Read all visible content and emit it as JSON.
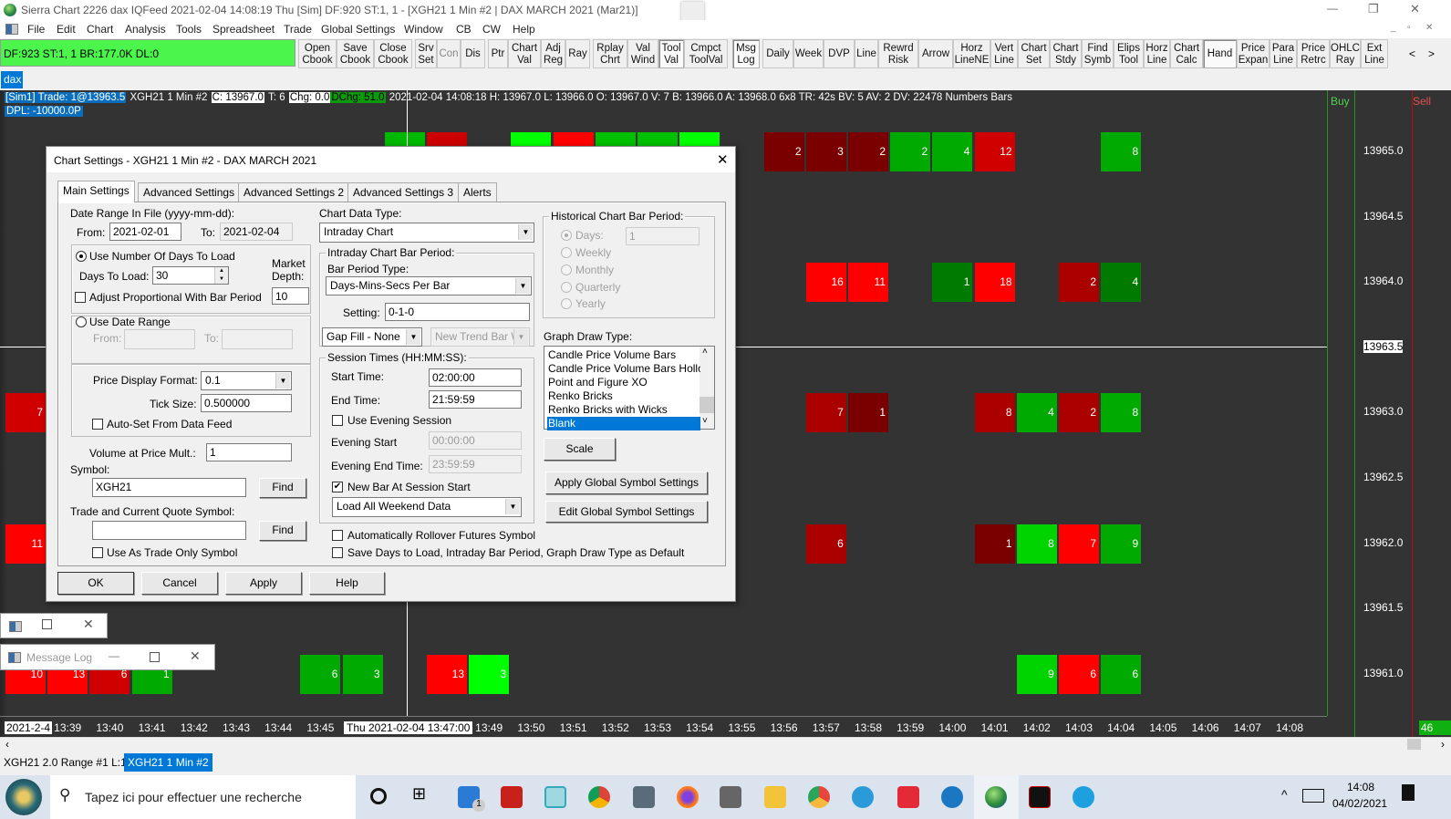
{
  "window": {
    "title": "Sierra Chart 2226 dax  IQFeed 2021-02-04  14:08:19 Thu [Sim]  DF:920  ST:1, 1 - [XGH21  1 Min   #2 | DAX MARCH 2021 (Mar21)]",
    "minimize": "—",
    "restore": "❐",
    "close": "✕"
  },
  "menu": [
    "File",
    "Edit",
    "Chart",
    "Analysis",
    "Tools",
    "Spreadsheet",
    "Trade",
    "Global Settings",
    "Window",
    "CB",
    "CW",
    "Help"
  ],
  "status_box": "DF:923  ST:1, 1  BR:177.0K  DL:0",
  "toolbar": [
    {
      "label": "Open\nCbook"
    },
    {
      "label": "Save\nCbook"
    },
    {
      "label": "Close\nCbook"
    },
    {
      "label": "Srv\nSet"
    },
    {
      "label": "Con",
      "disabled": true
    },
    {
      "label": "Dis"
    },
    {
      "label": "Ptr"
    },
    {
      "label": "Chart\nVal"
    },
    {
      "label": "Adj\nReg"
    },
    {
      "label": "Ray"
    },
    {
      "label": "Rplay\nChrt"
    },
    {
      "label": "Val\nWind"
    },
    {
      "label": "Tool\nVal",
      "pressed": true
    },
    {
      "label": "Cmpct\nToolVal"
    },
    {
      "label": "Msg\nLog",
      "pressed": true
    },
    {
      "label": "Daily"
    },
    {
      "label": "Week"
    },
    {
      "label": "DVP"
    },
    {
      "label": "Line"
    },
    {
      "label": "Rewrd\nRisk"
    },
    {
      "label": "Arrow"
    },
    {
      "label": "Horz\nLineNE"
    },
    {
      "label": "Vert\nLine"
    },
    {
      "label": "Chart\nSet"
    },
    {
      "label": "Chart\nStdy"
    },
    {
      "label": "Find\nSymb"
    },
    {
      "label": "Elips\nTool"
    },
    {
      "label": "Horz\nLine"
    },
    {
      "label": "Chart\nCalc"
    },
    {
      "label": "Hand",
      "pressed": true
    },
    {
      "label": "Price\nExpan"
    },
    {
      "label": "Para\nLine"
    },
    {
      "label": "Price\nRetrc"
    },
    {
      "label": "OHLC\nRay"
    },
    {
      "label": "Ext\nLine"
    }
  ],
  "toolbar_scroll": {
    "left": "<",
    "right": ">"
  },
  "chart_tab": "dax",
  "chart": {
    "header": {
      "trade": "[Sim1]  Trade: 1@13963.5",
      "symbol": "XGH21  1 Min   #2",
      "close": "C: 13967.0",
      "ticks": "T: 6",
      "change": "Chg: 0.0",
      "daily_change": "DChg: 51.0",
      "details": "2021-02-04 14:08:18 H: 13967.0 L: 13966.0 O: 13967.0 V: 7 B: 13966.0 A: 13968.0 6x8 TR: 42s BV: 5 AV: 2 DV: 22478 Numbers Bars"
    },
    "dpl": "DPL: -10000.0P",
    "buy_label": "Buy",
    "sell_label": "Sell",
    "price_labels": [
      "13965.0",
      "13964.5",
      "13964.0",
      "13963.5",
      "13963.0",
      "13962.5",
      "13962.0",
      "13961.5",
      "13961.0"
    ],
    "current_price": "13963.5",
    "date_label": "2021-2-4",
    "cursor_label": "Thu 2021-02-04  13:47:00",
    "time_labels": [
      "13:39",
      "13:40",
      "13:41",
      "13:42",
      "13:43",
      "13:44",
      "13:45",
      "13:49",
      "13:50",
      "13:51",
      "13:52",
      "13:53",
      "13:54",
      "13:55",
      "13:56",
      "13:57",
      "13:58",
      "13:59",
      "14:00",
      "14:01",
      "14:02",
      "14:03",
      "14:04",
      "14:05",
      "14:06",
      "14:07",
      "14:08"
    ],
    "corner_badge": "46",
    "colors": {
      "background": "#333333",
      "dark_red": "#7a0000",
      "mid_red": "#aa0000",
      "red": "#d00000",
      "bright_red": "#ff0000",
      "dark_green": "#007a00",
      "green": "#00aa00",
      "bright_green": "#00d400",
      "lime": "#00ff00"
    },
    "cells": [
      {
        "time": "13:47",
        "price": 13965.0,
        "volume": "",
        "color": "#00b800"
      },
      {
        "time": "13:48",
        "price": 13965.0,
        "volume": "",
        "color": "#cc0000"
      },
      {
        "time": "13:50",
        "price": 13965.0,
        "volume": "",
        "color": "#00ff00"
      },
      {
        "time": "13:51",
        "price": 13965.0,
        "volume": "",
        "color": "#ff0000"
      },
      {
        "time": "13:52",
        "price": 13965.0,
        "volume": "",
        "color": "#00c000"
      },
      {
        "time": "13:53",
        "price": 13965.0,
        "volume": "",
        "color": "#00c000"
      },
      {
        "time": "13:54",
        "price": 13965.0,
        "volume": "",
        "color": "#00ff00"
      },
      {
        "time": "13:56",
        "price": 13965.0,
        "volume": "2",
        "color": "#7a0000"
      },
      {
        "time": "13:57",
        "price": 13965.0,
        "volume": "3",
        "color": "#7a0000"
      },
      {
        "time": "13:58",
        "price": 13965.0,
        "volume": "2",
        "color": "#7a0000"
      },
      {
        "time": "13:59",
        "price": 13965.0,
        "volume": "2",
        "color": "#00aa00"
      },
      {
        "time": "14:00",
        "price": 13965.0,
        "volume": "4",
        "color": "#00aa00"
      },
      {
        "time": "14:01",
        "price": 13965.0,
        "volume": "12",
        "color": "#d00000"
      },
      {
        "time": "14:04",
        "price": 13965.0,
        "volume": "8",
        "color": "#00aa00"
      },
      {
        "time": "13:57",
        "price": 13964.0,
        "volume": "16",
        "color": "#ff0000"
      },
      {
        "time": "13:58",
        "price": 13964.0,
        "volume": "11",
        "color": "#ff0000"
      },
      {
        "time": "14:00",
        "price": 13964.0,
        "volume": "1",
        "color": "#007a00"
      },
      {
        "time": "14:01",
        "price": 13964.0,
        "volume": "18",
        "color": "#ff0000"
      },
      {
        "time": "14:03",
        "price": 13964.0,
        "volume": "2",
        "color": "#aa0000"
      },
      {
        "time": "14:04",
        "price": 13964.0,
        "volume": "4",
        "color": "#007a00"
      },
      {
        "time": "13:38",
        "price": 13963.0,
        "volume": "7",
        "color": "#d00000"
      },
      {
        "time": "13:57",
        "price": 13963.0,
        "volume": "7",
        "color": "#aa0000"
      },
      {
        "time": "13:58",
        "price": 13963.0,
        "volume": "1",
        "color": "#7a0000"
      },
      {
        "time": "14:01",
        "price": 13963.0,
        "volume": "8",
        "color": "#aa0000"
      },
      {
        "time": "14:02",
        "price": 13963.0,
        "volume": "4",
        "color": "#00aa00"
      },
      {
        "time": "14:03",
        "price": 13963.0,
        "volume": "2",
        "color": "#aa0000"
      },
      {
        "time": "14:04",
        "price": 13963.0,
        "volume": "8",
        "color": "#00aa00"
      },
      {
        "time": "13:38",
        "price": 13962.0,
        "volume": "11",
        "color": "#ff0000"
      },
      {
        "time": "13:57",
        "price": 13962.0,
        "volume": "6",
        "color": "#aa0000"
      },
      {
        "time": "14:01",
        "price": 13962.0,
        "volume": "1",
        "color": "#7a0000"
      },
      {
        "time": "14:02",
        "price": 13962.0,
        "volume": "8",
        "color": "#00d400"
      },
      {
        "time": "14:03",
        "price": 13962.0,
        "volume": "7",
        "color": "#ff0000"
      },
      {
        "time": "14:04",
        "price": 13962.0,
        "volume": "9",
        "color": "#00aa00"
      },
      {
        "time": "13:38",
        "price": 13961.0,
        "volume": "10",
        "color": "#ff0000"
      },
      {
        "time": "13:39",
        "price": 13961.0,
        "volume": "13",
        "color": "#ff0000"
      },
      {
        "time": "13:40",
        "price": 13961.0,
        "volume": "6",
        "color": "#d00000"
      },
      {
        "time": "13:41",
        "price": 13961.0,
        "volume": "1",
        "color": "#00aa00"
      },
      {
        "time": "13:45",
        "price": 13961.0,
        "volume": "6",
        "color": "#00aa00"
      },
      {
        "time": "13:46",
        "price": 13961.0,
        "volume": "3",
        "color": "#00aa00"
      },
      {
        "time": "13:48",
        "price": 13961.0,
        "volume": "13",
        "color": "#ff0000"
      },
      {
        "time": "13:49",
        "price": 13961.0,
        "volume": "3",
        "color": "#00ff00"
      },
      {
        "time": "14:02",
        "price": 13961.0,
        "volume": "9",
        "color": "#00d400"
      },
      {
        "time": "14:03",
        "price": 13961.0,
        "volume": "6",
        "color": "#ff0000"
      },
      {
        "time": "14:04",
        "price": 13961.0,
        "volume": "6",
        "color": "#00aa00"
      }
    ]
  },
  "dialog": {
    "title": "Chart Settings - XGH21  1 Min   #2 - DAX MARCH 2021",
    "close": "✕",
    "tabs": [
      "Main Settings",
      "Advanced Settings",
      "Advanced Settings 2",
      "Advanced Settings 3",
      "Alerts"
    ],
    "date_range_label": "Date Range In File (yyyy-mm-dd):",
    "from_label": "From:",
    "from_value": "2021-02-01",
    "to_label": "To:",
    "to_value": "2021-02-04",
    "use_days_label": "Use Number Of Days To Load",
    "days_to_load_label": "Days To Load:",
    "days_to_load_value": "30",
    "market_depth_label_1": "Market",
    "market_depth_label_2": "Depth:",
    "market_depth_value": "10",
    "adjust_proportional_label": "Adjust Proportional With Bar Period",
    "use_date_range_label": "Use Date Range",
    "range_from_label": "From:",
    "range_to_label": "To:",
    "price_display_format_label": "Price Display Format:",
    "price_display_format_value": "0.1",
    "tick_size_label": "Tick Size:",
    "tick_size_value": "0.500000",
    "auto_set_label": "Auto-Set From Data Feed",
    "vap_mult_label": "Volume at Price Mult.:",
    "vap_mult_value": "1",
    "symbol_label": "Symbol:",
    "symbol_value": "XGH21",
    "find_label": "Find",
    "trade_symbol_label": "Trade and Current Quote Symbol:",
    "trade_symbol_value": "",
    "trade_only_label": "Use As Trade Only Symbol",
    "chart_data_type_label": "Chart Data Type:",
    "chart_data_type_value": "Intraday Chart",
    "intraday_period_label": "Intraday Chart Bar Period:",
    "bar_period_type_label": "Bar Period Type:",
    "bar_period_type_value": "Days-Mins-Secs Per Bar",
    "setting_label": "Setting:",
    "setting_value": "0-1-0",
    "gap_fill_value": "Gap Fill - None",
    "new_trend_value": "New Trend Bar W",
    "session_times_label": "Session Times (HH:MM:SS):",
    "start_time_label": "Start Time:",
    "start_time_value": "02:00:00",
    "end_time_label": "End Time:",
    "end_time_value": "21:59:59",
    "use_evening_label": "Use Evening Session",
    "evening_start_label": "Evening Start",
    "evening_start_value": "00:00:00",
    "evening_end_label": "Evening End Time:",
    "evening_end_value": "23:59:59",
    "new_bar_label": "New Bar At Session Start",
    "weekend_value": "Load All Weekend Data",
    "rollover_label": "Automatically Rollover Futures Symbol",
    "save_default_label": "Save Days to Load, Intraday Bar Period, Graph Draw Type as Default",
    "historical_label": "Historical Chart Bar Period:",
    "hist_days_label": "Days:",
    "hist_days_value": "1",
    "hist_weekly": "Weekly",
    "hist_monthly": "Monthly",
    "hist_quarterly": "Quarterly",
    "hist_yearly": "Yearly",
    "graph_draw_type_label": "Graph Draw Type:",
    "graph_draw_types": [
      "Candle Price Volume Bars",
      "Candle Price Volume Bars Hollow",
      "Point and Figure XO",
      "Renko Bricks",
      "Renko Bricks with Wicks",
      "Blank"
    ],
    "graph_draw_type_selected": "Blank",
    "scale_label": "Scale",
    "apply_global_label": "Apply Global Symbol Settings",
    "edit_global_label": "Edit Global Symbol Settings",
    "ok_label": "OK",
    "cancel_label": "Cancel",
    "apply_label": "Apply",
    "help_label": "Help"
  },
  "message_log": {
    "title": "Message Log"
  },
  "chart_tabs": [
    "XGH21  2.0 Range  #1 L:1",
    "XGH21  1 Min   #2"
  ],
  "taskbar": {
    "search_placeholder": "Tapez ici pour effectuer une recherche",
    "mail_badge": "1",
    "time": "14:08",
    "date": "04/02/2021"
  }
}
